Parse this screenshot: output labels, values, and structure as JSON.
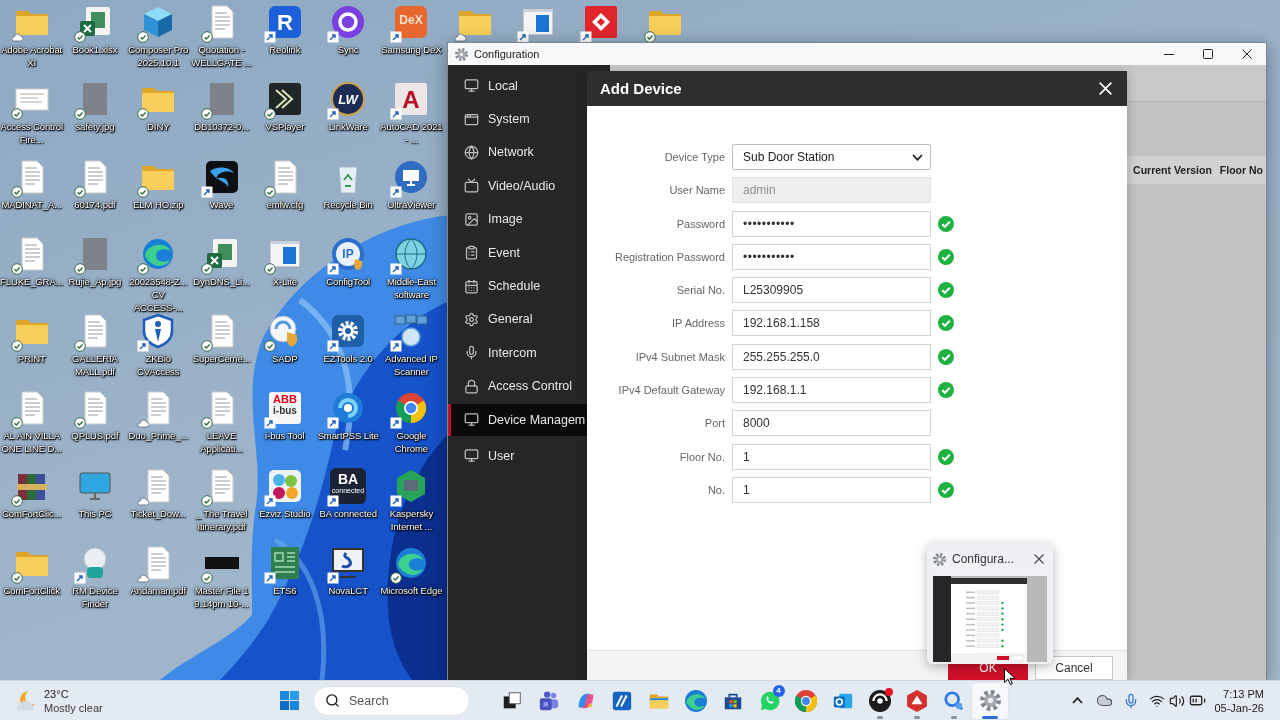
{
  "desktop": {
    "rows": [
      {
        "icons": [
          {
            "label": "Adobe Acrobat XI",
            "kind": "folder",
            "badge": {
              "kind": "cloud"
            }
          },
          {
            "label": "Book1.xlsx",
            "kind": "sheet",
            "badge": {
              "kind": "check"
            }
          },
          {
            "label": "Composer Pro 2025.10.1",
            "kind": "cube",
            "badge": {
              "kind": "check"
            }
          },
          {
            "label": "Quotation - WELLGATE ...",
            "kind": "doc",
            "badge": {
              "kind": "check"
            }
          },
          {
            "label": "Reolink",
            "kind": "bluetile",
            "logo": "R",
            "badge": {
              "kind": "shortcut"
            }
          },
          {
            "label": "Sync",
            "kind": "ring",
            "badge": {
              "kind": "shortcut"
            }
          },
          {
            "label": "Samsung DeX",
            "kind": "orangetile",
            "logo": "DeX",
            "badge": {
              "kind": "shortcut"
            }
          },
          {
            "kind": "folder",
            "badge": {
              "kind": "cloud"
            }
          },
          {
            "kind": "window",
            "badge": {
              "kind": "shortcut"
            }
          },
          {
            "kind": "diamond",
            "badge": {
              "kind": "shortcut"
            }
          },
          {
            "kind": "folder",
            "badge": {
              "kind": "check"
            }
          }
        ]
      },
      {
        "icons": [
          {
            "label": "Access Control Fire...",
            "kind": "page",
            "badge": {
              "kind": "check"
            }
          },
          {
            "label": "safety.jpg",
            "kind": "photo",
            "badge": {
              "kind": "check"
            }
          },
          {
            "label": "DINY",
            "kind": "folder",
            "badge": {
              "kind": "check"
            }
          },
          {
            "label": "DB10372-0...",
            "kind": "photo",
            "badge": {
              "kind": "check"
            }
          },
          {
            "label": "VSPlayer",
            "kind": "playtile",
            "badge": {
              "kind": "check"
            }
          },
          {
            "label": "LinkWare",
            "kind": "goldring",
            "logo": "LW",
            "badge": {
              "kind": "shortcut"
            }
          },
          {
            "label": "AutoCAD 2021 - ...",
            "kind": "paletile",
            "logo": "A",
            "badge": {
              "kind": "shortcut"
            }
          }
        ]
      },
      {
        "icons": [
          {
            "label": "MADINAT_A...",
            "kind": "doc",
            "badge": {
              "kind": "check"
            }
          },
          {
            "label": "60174.pdf",
            "kind": "doc",
            "badge": {
              "kind": "check"
            }
          },
          {
            "label": "ELM HO.zip",
            "kind": "folder",
            "badge": {
              "kind": "check"
            }
          },
          {
            "label": "Wave",
            "kind": "wave",
            "badge": {
              "kind": "shortcut"
            }
          },
          {
            "label": "emfw.cfg",
            "kind": "doc",
            "badge": {
              "kind": "check"
            }
          },
          {
            "label": "Recycle Bin",
            "kind": "recycle"
          },
          {
            "label": "UltraViewer",
            "kind": "monitorcircle",
            "badge": {
              "kind": "shortcut"
            }
          }
        ]
      },
      {
        "icons": [
          {
            "label": "FLUKE_GRA...",
            "kind": "doc",
            "badge": {
              "kind": "check"
            }
          },
          {
            "label": "Rujie_Ap.jpg",
            "kind": "photo",
            "badge": {
              "kind": "check"
            }
          },
          {
            "label": "20023548-Z... CV ACCESS-...",
            "kind": "edge",
            "badge": {
              "kind": "check"
            }
          },
          {
            "label": "DynDNS_Li...",
            "kind": "sheet",
            "badge": {
              "kind": "check"
            }
          },
          {
            "label": "X-Lite",
            "kind": "window",
            "badge": {
              "kind": "check"
            }
          },
          {
            "label": "ConfigTool",
            "kind": "ipcircle",
            "logo": "IP",
            "badge": {
              "kind": "shortcut"
            }
          },
          {
            "label": "Middle-East software",
            "kind": "globe",
            "badge": {
              "kind": "shortcut"
            }
          }
        ]
      },
      {
        "icons": [
          {
            "label": "PRINT",
            "kind": "folder",
            "badge": {
              "kind": "check"
            }
          },
          {
            "label": "GALLERIA MALL.pdf",
            "kind": "doc",
            "badge": {
              "kind": "check"
            }
          },
          {
            "label": "ZKBio CVAccess",
            "kind": "shield",
            "badge": {
              "kind": "shortcut"
            }
          },
          {
            "label": "SuperCeme...",
            "kind": "doc",
            "badge": {
              "kind": "check"
            }
          },
          {
            "label": "SADP",
            "kind": "sadp",
            "badge": {
              "kind": "check"
            }
          },
          {
            "label": "EZTools 2.0",
            "kind": "geartile",
            "badge": {
              "kind": "shortcut"
            }
          },
          {
            "label": "Advanced IP Scanner",
            "kind": "network",
            "badge": {
              "kind": "shortcut"
            }
          }
        ]
      },
      {
        "icons": [
          {
            "label": "AL AIN VILLA ONE LINE D...",
            "kind": "doc",
            "badge": {
              "kind": "check"
            }
          },
          {
            "label": "QPLUS.pdf",
            "kind": "doc",
            "badge": {
              "kind": "check"
            }
          },
          {
            "label": "Duo_Prime_...",
            "kind": "doc",
            "badge": {
              "kind": "cloud"
            }
          },
          {
            "label": "LEAVE Applicati...",
            "kind": "doc",
            "badge": {
              "kind": "check"
            }
          },
          {
            "label": "i-bus Tool",
            "kind": "abb",
            "logo": "ABB",
            "logo_sub": "i-bus",
            "badge": {
              "kind": "shortcut"
            }
          },
          {
            "label": "SmartPSS Lite",
            "kind": "swirl",
            "badge": {
              "kind": "shortcut"
            }
          },
          {
            "label": "Google Chrome",
            "kind": "chrome",
            "badge": {
              "kind": "shortcut"
            }
          }
        ]
      },
      {
        "icons": [
          {
            "label": "ComFortClic...",
            "kind": "books",
            "badge": {
              "kind": "check"
            }
          },
          {
            "label": "This PC",
            "kind": "pc"
          },
          {
            "label": "Ticket_Dow...",
            "kind": "doc",
            "badge": {
              "kind": "cloud"
            }
          },
          {
            "label": "_ The Travel Itinerary.pdf",
            "kind": "doc",
            "badge": {
              "kind": "check"
            }
          },
          {
            "label": "Ezviz Studio",
            "kind": "dots",
            "badge": {
              "kind": "shortcut"
            }
          },
          {
            "label": "BA connected",
            "kind": "darktile",
            "logo": "BA",
            "logo_sub": "connected",
            "badge": {
              "kind": "shortcut"
            }
          },
          {
            "label": "Kaspersky Internet ...",
            "kind": "hexagon",
            "badge": {
              "kind": "shortcut"
            }
          }
        ]
      },
      {
        "icons": [
          {
            "label": "ComFortClick",
            "kind": "folder",
            "badge": {
              "kind": "check"
            }
          },
          {
            "label": "RM Device Finder",
            "kind": "lens",
            "badge": {
              "kind": "shortcut"
            }
          },
          {
            "label": "Andaman.pdf",
            "kind": "doc",
            "badge": {
              "kind": "cloud"
            }
          },
          {
            "label": "Master File 1 9.14pm 10-...",
            "kind": "thumb",
            "badge": {
              "kind": "check"
            }
          },
          {
            "label": "ETS6",
            "kind": "board",
            "badge": {
              "kind": "shortcut"
            }
          },
          {
            "label": "NovaLCT",
            "kind": "novalct",
            "badge": {
              "kind": "shortcut"
            }
          },
          {
            "label": "Microsoft Edge",
            "kind": "edge",
            "badge": {
              "kind": "check"
            }
          }
        ]
      }
    ]
  },
  "window": {
    "title": "Configuration",
    "sidebar": {
      "items": [
        {
          "label": "Local",
          "selected": false
        },
        {
          "label": "System",
          "selected": false
        },
        {
          "label": "Network",
          "selected": false
        },
        {
          "label": "Video/Audio",
          "selected": false
        },
        {
          "label": "Image",
          "selected": false
        },
        {
          "label": "Event",
          "selected": false
        },
        {
          "label": "Schedule",
          "selected": false
        },
        {
          "label": "General",
          "selected": false
        },
        {
          "label": "Intercom",
          "selected": false
        },
        {
          "label": "Access Control",
          "selected": false
        },
        {
          "label": "Device Managem",
          "selected": true
        },
        {
          "label": "User",
          "selected": false
        }
      ]
    },
    "table": {
      "columns": [
        "Current Version",
        "Floor No"
      ]
    }
  },
  "dialog": {
    "title": "Add Device",
    "fields": [
      {
        "label": "Device Type",
        "kind": "select",
        "value": "Sub Door Station",
        "disabled": false,
        "valid": false
      },
      {
        "label": "User Name",
        "kind": "text",
        "value": "admin",
        "disabled": true,
        "valid": false
      },
      {
        "label": "Password",
        "kind": "password",
        "value": "•••••••••••",
        "disabled": false,
        "valid": true
      },
      {
        "label": "Registration Password",
        "kind": "password",
        "value": "•••••••••••",
        "disabled": false,
        "valid": true
      },
      {
        "label": "Serial No.",
        "kind": "text",
        "value": "L25309905",
        "disabled": false,
        "valid": true
      },
      {
        "label": "IP Address",
        "kind": "text",
        "value": "192.168.1.158",
        "disabled": false,
        "valid": true
      },
      {
        "label": "IPv4 Subnet Mask",
        "kind": "text",
        "value": "255.255.255.0",
        "disabled": false,
        "valid": true
      },
      {
        "label": "IPv4 Default Gateway",
        "kind": "text",
        "value": "192.168.1.1",
        "disabled": false,
        "valid": true
      },
      {
        "label": "Port",
        "kind": "text",
        "value": "8000",
        "disabled": false,
        "valid": false
      },
      {
        "label": "Floor No.",
        "kind": "text",
        "value": "1",
        "disabled": false,
        "valid": true
      },
      {
        "label": "No.",
        "kind": "text",
        "value": "1",
        "disabled": false,
        "valid": true
      }
    ],
    "buttons": [
      {
        "label": "OK",
        "kind": "primary"
      },
      {
        "label": "Cancel",
        "kind": "secondary"
      }
    ]
  },
  "preview": {
    "title": "Configura..."
  },
  "taskbar": {
    "weather": {
      "temperature": "23°C",
      "condition": "Mostly clear"
    },
    "search": {
      "placeholder": "Search"
    },
    "apps": [
      {
        "kind": "taskview",
        "running": false,
        "active": false,
        "dot": false
      },
      {
        "kind": "teams",
        "running": false,
        "active": false,
        "dot": false
      },
      {
        "kind": "copilot",
        "running": false,
        "active": false,
        "dot": false
      },
      {
        "kind": "slashtile",
        "running": false,
        "active": false,
        "dot": false
      },
      {
        "kind": "explorer",
        "running": false,
        "active": false,
        "dot": false
      },
      {
        "kind": "edge",
        "running": false,
        "active": false,
        "dot": false
      },
      {
        "kind": "store",
        "running": false,
        "active": false,
        "dot": false
      },
      {
        "kind": "whatsapp",
        "running": false,
        "active": false,
        "dot": false,
        "badge": "4"
      },
      {
        "kind": "chrome",
        "running": false,
        "active": false,
        "dot": false
      },
      {
        "kind": "outlook",
        "running": false,
        "active": false,
        "dot": false
      },
      {
        "kind": "disc",
        "running": true,
        "active": false,
        "dot": true
      },
      {
        "kind": "redhex",
        "running": true,
        "active": false,
        "dot": false
      },
      {
        "kind": "finder",
        "running": true,
        "active": false,
        "dot": false
      },
      {
        "kind": "gear",
        "running": true,
        "active": true,
        "dot": false
      }
    ],
    "clock": {
      "time": "7:13 PM",
      "date": "05-Jan-26"
    }
  }
}
